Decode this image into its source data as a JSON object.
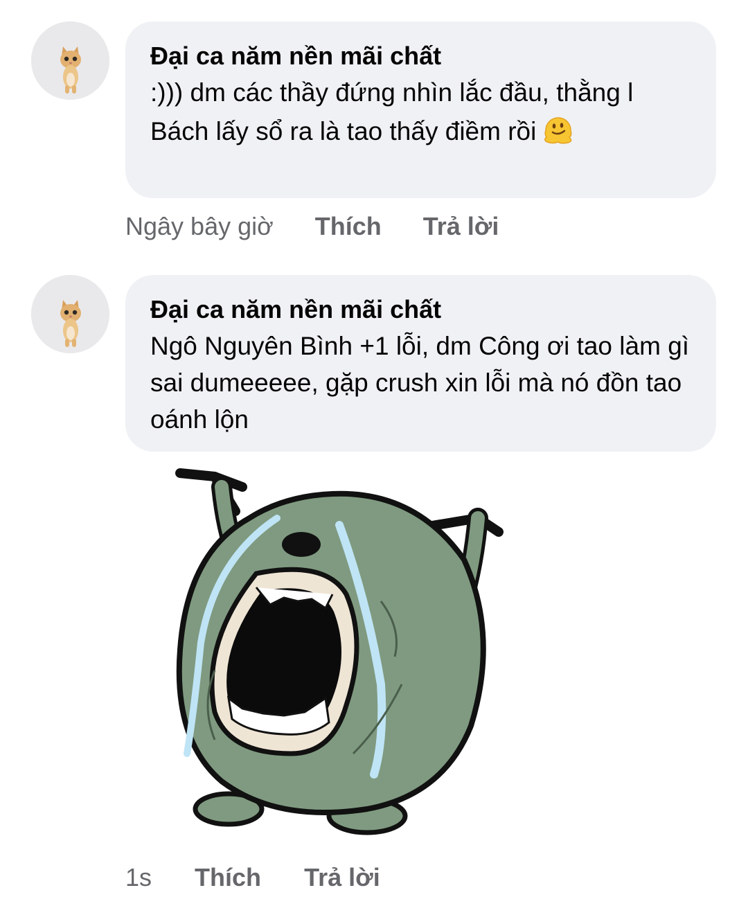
{
  "comments": [
    {
      "author": "Đại ca năm nền mãi chất",
      "text": ":))) dm các thầy đứng nhìn lắc đầu, thằng l Bách lấy sổ ra là tao thấy điềm rồi",
      "emoji": "melting-face-emoji",
      "time": "Ngây bây giờ",
      "like_label": "Thích",
      "reply_label": "Trả lời",
      "avatar": "kitten-avatar"
    },
    {
      "author": "Đại ca năm nền mãi chất",
      "text": "Ngô Nguyên Bình +1 lỗi, dm Công ơi tao làm gì sai dumeeeee, gặp crush xin lỗi mà nó đồn tao oánh lộn",
      "sticker": "crying-green-blob-sticker",
      "time": "1s",
      "like_label": "Thích",
      "reply_label": "Trả lời",
      "avatar": "kitten-avatar"
    }
  ],
  "colors": {
    "bubble": "#f0f1f5",
    "meta_text": "#65676b",
    "sticker_body": "#7f9a80",
    "tears": "#bfe4f5"
  }
}
